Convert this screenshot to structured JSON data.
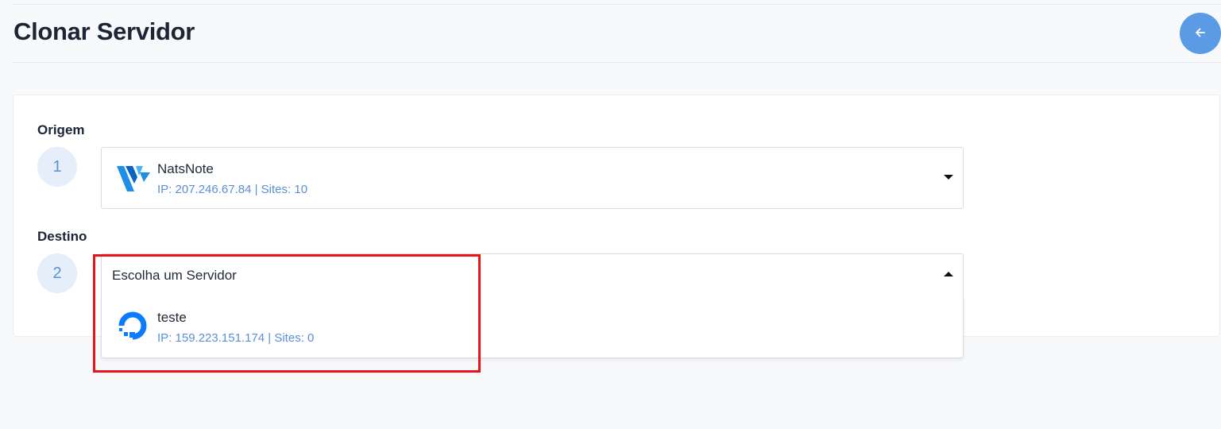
{
  "page": {
    "title": "Clonar Servidor"
  },
  "back_button": {
    "icon": "arrow-left-icon",
    "color": "#5b9be6"
  },
  "origin": {
    "label": "Origem",
    "step": "1",
    "selected": {
      "name": "NatsNote",
      "meta": "IP: 207.246.67.84 | Sites: 10",
      "provider_icon": "vultr-logo-icon"
    }
  },
  "destination": {
    "label": "Destino",
    "step": "2",
    "placeholder": "Escolha um Servidor",
    "options": [
      {
        "name": "teste",
        "meta": "IP: 159.223.151.174 | Sites: 0",
        "provider_icon": "digitalocean-logo-icon"
      }
    ]
  },
  "colors": {
    "accent": "#5b8fd6",
    "highlight": "#e8141b"
  }
}
